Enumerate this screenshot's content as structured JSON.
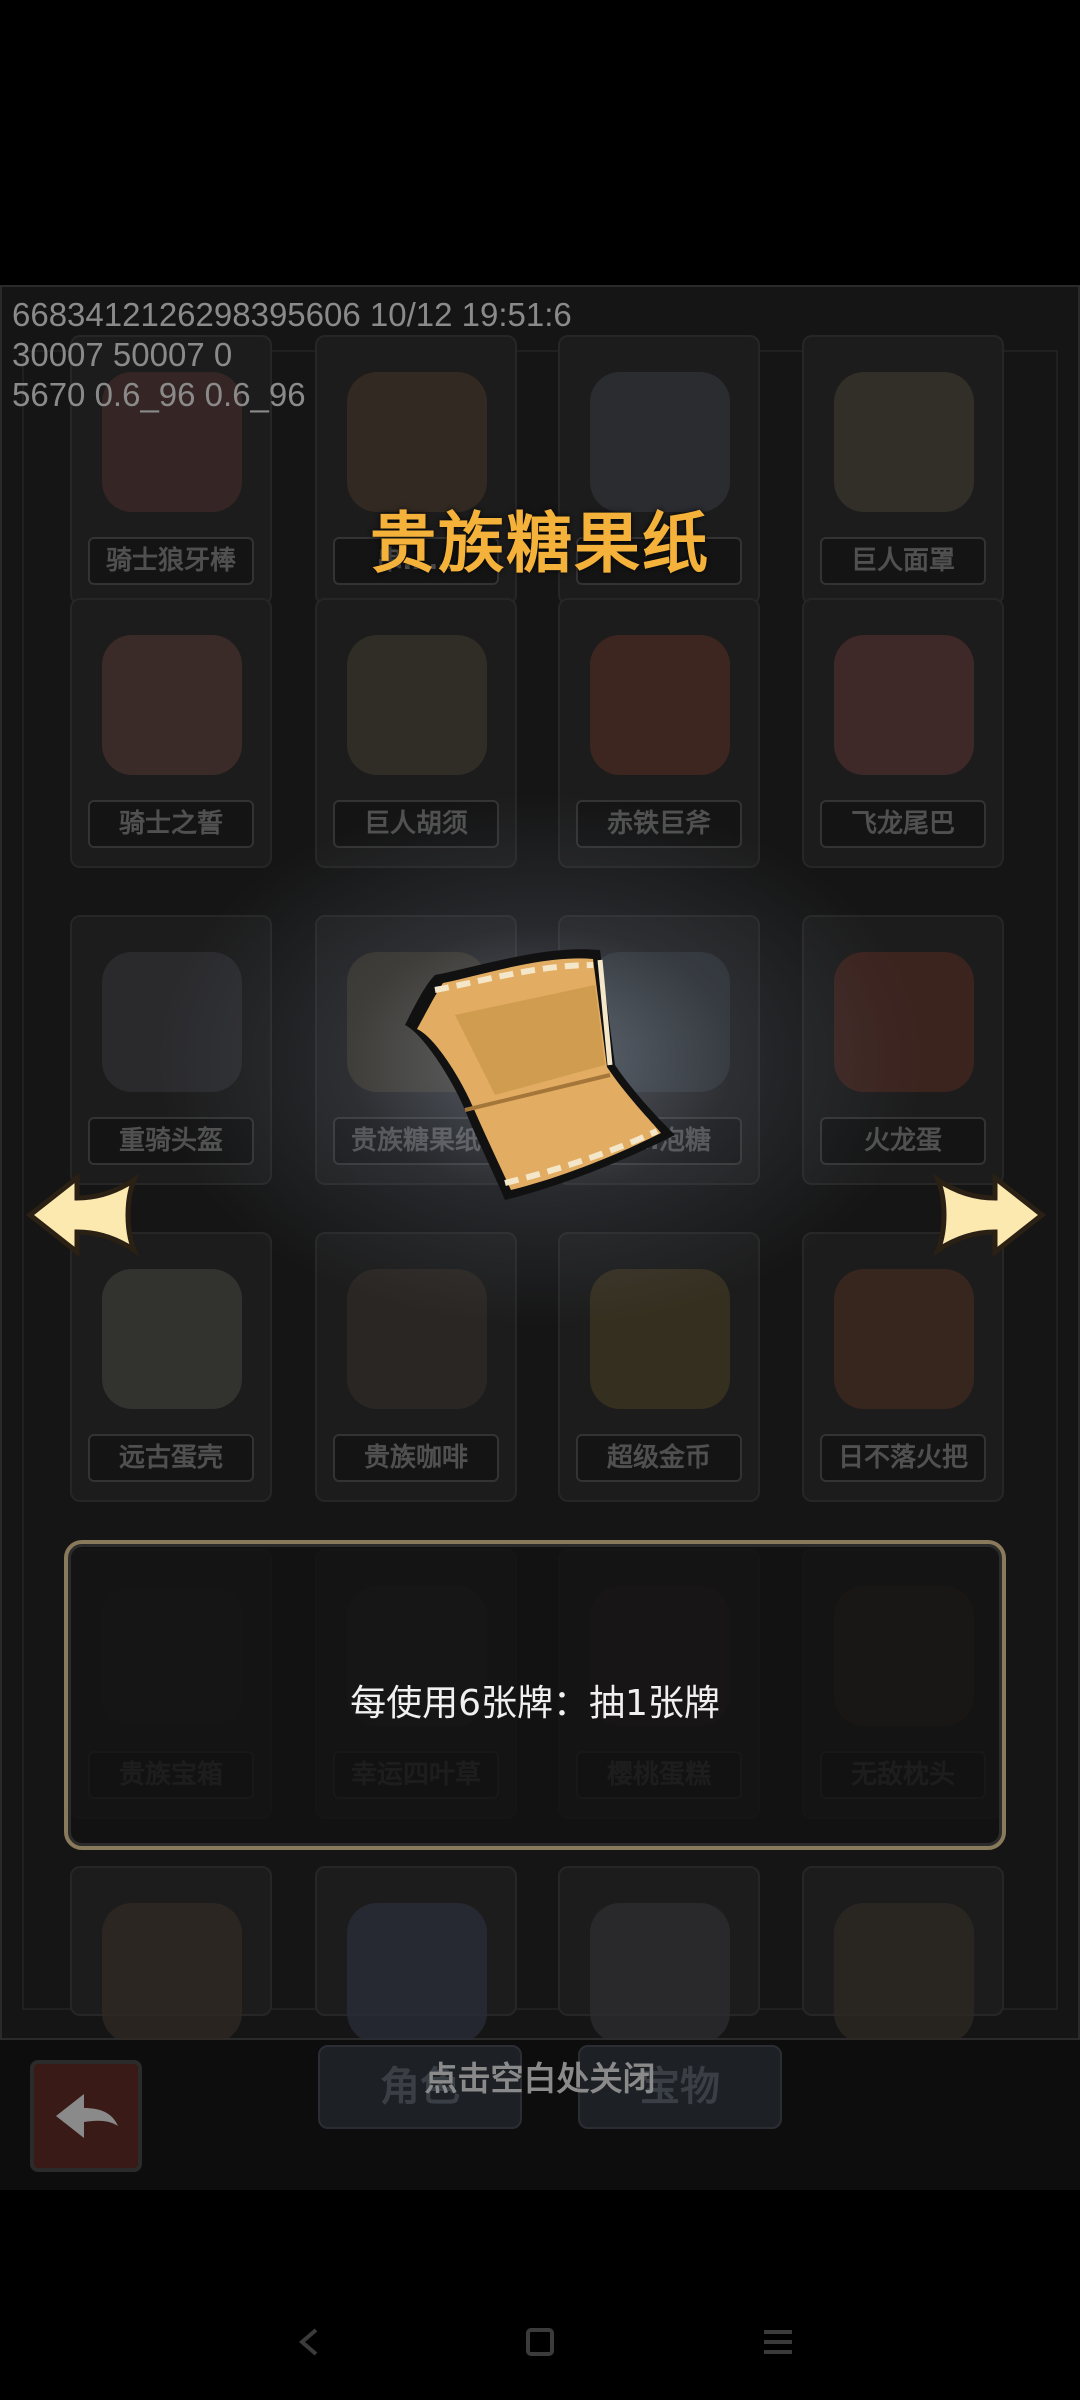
{
  "debug_lines": [
    "6683412126298395606 10/12 19:51:6",
    "30007 50007 0",
    "5670 0.6_96 0.6_96"
  ],
  "item_title": "贵族糖果纸",
  "item_description": "每使用6张牌：抽1张牌",
  "close_hint": "点击空白处关闭",
  "grid_items": [
    {
      "label": "骑士狼牙棒"
    },
    {
      "label": "串……"
    },
    {
      "label": ""
    },
    {
      "label": "巨人面罩"
    },
    {
      "label": "骑士之誓"
    },
    {
      "label": "巨人胡须"
    },
    {
      "label": "赤铁巨斧"
    },
    {
      "label": "飞龙尾巴"
    },
    {
      "label": "重骑头盔"
    },
    {
      "label": "贵族糖果纸"
    },
    {
      "label": "……泡糖"
    },
    {
      "label": "火龙蛋"
    },
    {
      "label": "远古蛋壳"
    },
    {
      "label": "贵族咖啡"
    },
    {
      "label": "超级金币"
    },
    {
      "label": "日不落火把"
    },
    {
      "label": "贵族宝箱"
    },
    {
      "label": "幸运四叶草"
    },
    {
      "label": "樱桃蛋糕"
    },
    {
      "label": "无敌枕头"
    },
    {
      "label": ""
    },
    {
      "label": ""
    },
    {
      "label": ""
    },
    {
      "label": ""
    }
  ],
  "tabs": [
    "角色",
    "宝物"
  ],
  "colors": {
    "title": "#f5b23a",
    "desc_border": "#8a7a5c",
    "arrow_fill": "#fbe9b0"
  },
  "icons": [
    "arrow-left-icon",
    "arrow-right-icon",
    "candy-wrapper-icon",
    "back-icon",
    "nav-back-icon",
    "nav-home-icon",
    "nav-menu-icon"
  ]
}
